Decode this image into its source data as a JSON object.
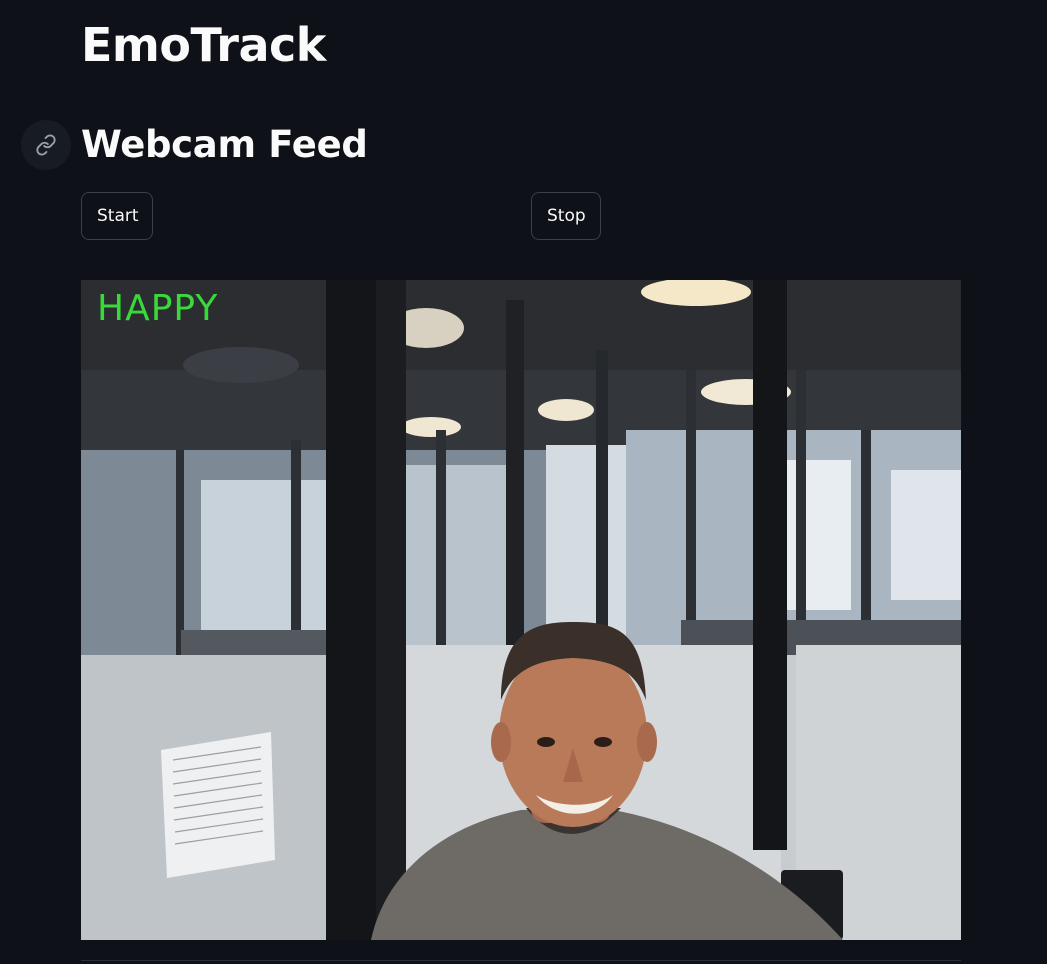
{
  "app": {
    "title": "EmoTrack"
  },
  "section": {
    "title": "Webcam Feed",
    "anchor_icon": "link-icon"
  },
  "controls": {
    "start_label": "Start",
    "stop_label": "Stop"
  },
  "feed": {
    "emotion_label": "HAPPY",
    "emotion_color": "#39d93a"
  },
  "theme": {
    "background": "#0e1117",
    "text": "#fafafa",
    "button_border": "#3b3f47"
  }
}
